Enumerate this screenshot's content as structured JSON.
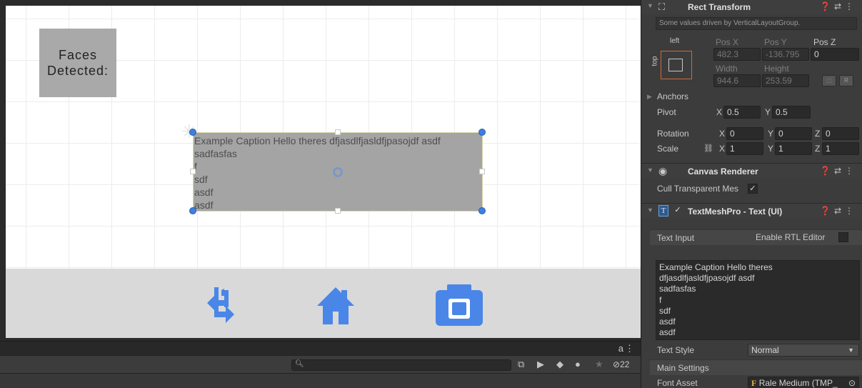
{
  "scene": {
    "faces_label_line1": "Faces",
    "faces_label_line2": "Detected:",
    "caption_lines": [
      "Example Caption Hello theres dfjasdlfjasldfjpasojdf asdf",
      "sadfasfas",
      "f",
      "sdf",
      "asdf",
      "asdf"
    ],
    "bottom_bar_icons": [
      "switch-camera-icon",
      "home-icon",
      "camera-icon"
    ],
    "accent_color": "#4a86e8"
  },
  "console": {
    "search_placeholder": "",
    "lock_icon": "a",
    "hidden_count": "22"
  },
  "inspector": {
    "rect_transform": {
      "title": "Rect Transform",
      "driven_note": "Some values driven by VerticalLayoutGroup.",
      "anchor_h": "left",
      "anchor_v": "top",
      "pos_x_label": "Pos X",
      "pos_y_label": "Pos Y",
      "pos_z_label": "Pos Z",
      "pos_x": "482.3",
      "pos_y": "-136.795",
      "pos_z": "0",
      "width_label": "Width",
      "height_label": "Height",
      "width": "944.6",
      "height": "253.59",
      "r_button": "R",
      "anchors_label": "Anchors",
      "pivot_label": "Pivot",
      "pivot_x": "0.5",
      "pivot_y": "0.5",
      "rotation_label": "Rotation",
      "rot_x": "0",
      "rot_y": "0",
      "rot_z": "0",
      "scale_label": "Scale",
      "scale_x": "1",
      "scale_y": "1",
      "scale_z": "1",
      "axis_x": "X",
      "axis_y": "Y",
      "axis_z": "Z"
    },
    "canvas_renderer": {
      "title": "Canvas Renderer",
      "cull_label": "Cull Transparent Mes",
      "cull_checked": "✓"
    },
    "textmeshpro": {
      "title": "TextMeshPro - Text (UI)",
      "enabled": "✓",
      "text_input_label": "Text Input",
      "rtl_label": "Enable RTL Editor",
      "text_lines": [
        "Example Caption Hello theres",
        "dfjasdlfjasldfjpasojdf asdf",
        "sadfasfas",
        "f",
        "sdf",
        "asdf",
        "asdf"
      ],
      "text_style_label": "Text Style",
      "text_style_value": "Normal",
      "main_settings_label": "Main Settings",
      "font_asset_label": "Font Asset",
      "font_asset_value": "Rale Medium (TMP_"
    }
  }
}
